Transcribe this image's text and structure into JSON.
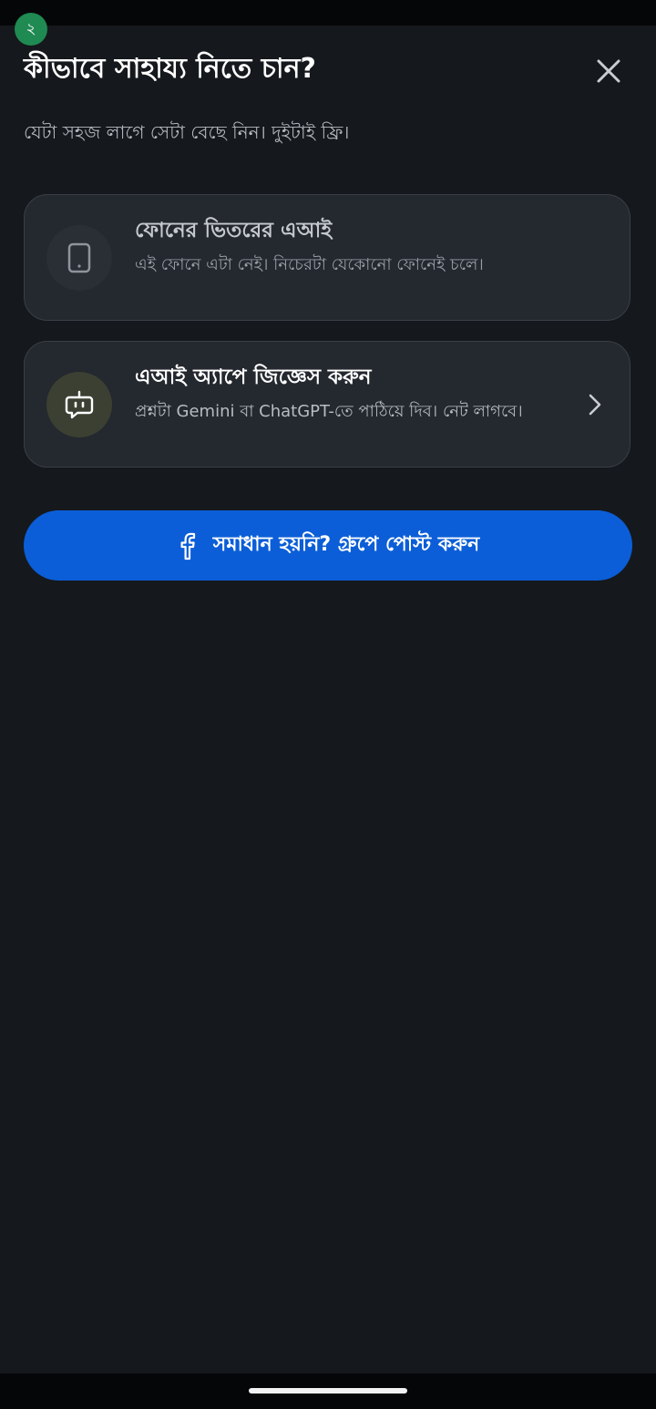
{
  "step_badge": "২",
  "title": "কীভাবে সাহায্য নিতে চান?",
  "subtitle": "যেটা সহজ লাগে সেটা বেছে নিন। দুইটাই ফ্রি।",
  "options": [
    {
      "icon": "smartphone-icon",
      "title": "ফোনের ভিতরের এআই",
      "description": "এই ফোনে এটা নেই। নিচেরটা যেকোনো ফোনেই চলে।",
      "enabled": false
    },
    {
      "icon": "robot-chat-icon",
      "title": "এআই অ্যাপে জিজ্ঞেস করুন",
      "description": "প্রশ্নটা Gemini বা ChatGPT-তে পাঠিয়ে দিব। নেট লাগবে।",
      "enabled": true
    }
  ],
  "group_button": {
    "icon": "facebook-icon",
    "label": "সমাধান হয়নি? গ্রুপে পোস্ট করুন"
  },
  "colors": {
    "background": "#15181c",
    "card": "#24282f",
    "accent_button": "#0b5ed7",
    "badge": "#1f8a52"
  }
}
